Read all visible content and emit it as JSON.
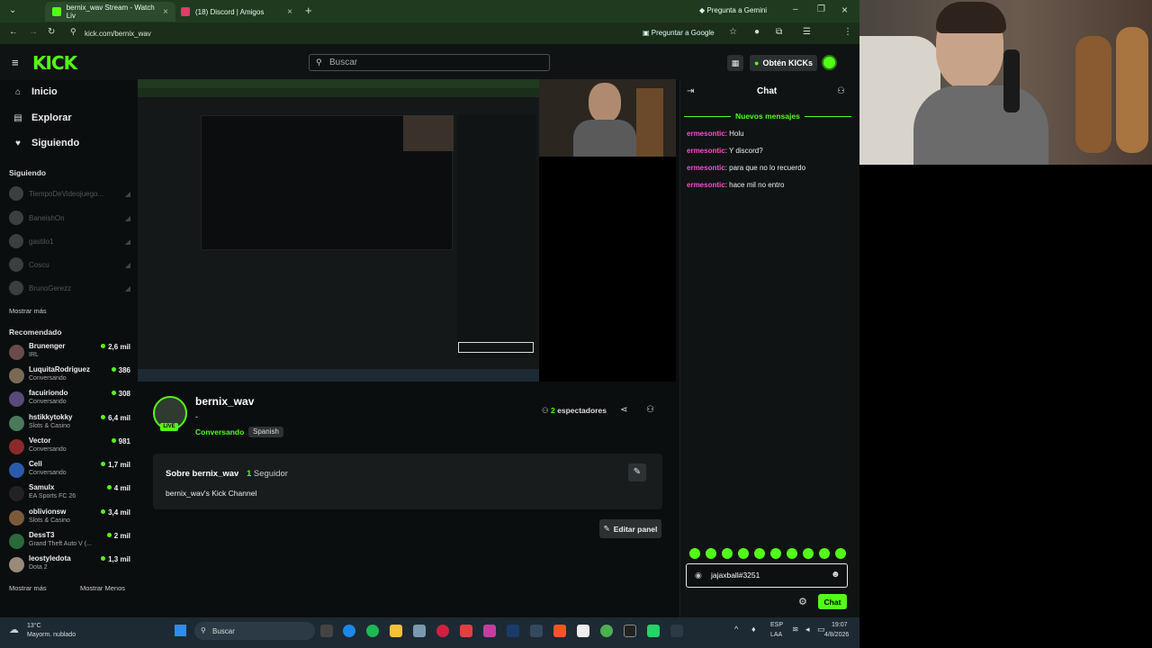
{
  "browser": {
    "tabs": [
      {
        "label": "bernix_wav Stream - Watch Liv",
        "favicon_color": "#53fc18"
      },
      {
        "label": "(18) Discord | Amigos",
        "favicon_color": "#5865f2"
      }
    ],
    "gemini_label": "Pregunta a Gemini",
    "url": "kick.com/bernix_wav",
    "ask_google_label": "Preguntar a Google"
  },
  "header": {
    "logo": "KICK",
    "search_placeholder": "Buscar",
    "get_kicks_label": "Obtén KICKs"
  },
  "sidebar": {
    "nav": [
      {
        "label": "Inicio",
        "icon": "home-icon"
      },
      {
        "label": "Explorar",
        "icon": "explore-icon"
      },
      {
        "label": "Siguiendo",
        "icon": "heart-icon"
      }
    ],
    "following_title": "Siguiendo",
    "following": [
      {
        "name": "TiempoDeVideojuego..."
      },
      {
        "name": "BaneishOn"
      },
      {
        "name": "gastilo1"
      },
      {
        "name": "Coscu"
      },
      {
        "name": "BrunoGerezz"
      }
    ],
    "show_more_1": "Mostrar más",
    "recommended_title": "Recomendado",
    "recommended": [
      {
        "name": "Brunenger",
        "category": "IRL",
        "viewers": "2,6 mil"
      },
      {
        "name": "LuquitaRodriguez",
        "category": "Conversando",
        "viewers": "386"
      },
      {
        "name": "facuiriondo",
        "category": "Conversando",
        "viewers": "308"
      },
      {
        "name": "hstikkytokky",
        "category": "Slots & Casino",
        "viewers": "6,4 mil"
      },
      {
        "name": "Vector",
        "category": "Conversando",
        "viewers": "981"
      },
      {
        "name": "Cell",
        "category": "Conversando",
        "viewers": "1,7 mil"
      },
      {
        "name": "Samulx",
        "category": "EA Sports FC 26",
        "viewers": "4 mil"
      },
      {
        "name": "oblivionsw",
        "category": "Slots & Casino",
        "viewers": "3,4 mil"
      },
      {
        "name": "DessT3",
        "category": "Grand Theft Auto V (...",
        "viewers": "2 mil"
      },
      {
        "name": "leostyledota",
        "category": "Dota 2",
        "viewers": "1,3 mil"
      }
    ],
    "show_more_2": "Mostrar más",
    "show_less": "Mostrar Menos"
  },
  "stream": {
    "streamer": "bernix_wav",
    "live_badge": "LIVE",
    "title_line": "-",
    "category": "Conversando",
    "language_tag": "Spanish",
    "viewers_count": "2",
    "viewers_label": "espectadores",
    "about_title": "Sobre bernix_wav",
    "followers_count": "1",
    "followers_label": "Seguidor",
    "about_text": "bernix_wav's Kick Channel",
    "edit_panel_label": "Editar panel"
  },
  "chat": {
    "title": "Chat",
    "new_messages": "Nuevos mensajes",
    "messages": [
      {
        "user": "ermesontic",
        "text": ": Holu"
      },
      {
        "user": "ermesontic",
        "text": ": Y discord?"
      },
      {
        "user": "ermesontic",
        "text": ": para que no lo recuerdo"
      },
      {
        "user": "ermesontic",
        "text": ": hace mil no entro"
      }
    ],
    "input_value": "jajaxball#3251",
    "send_label": "Chat"
  },
  "taskbar": {
    "weather_temp": "13°C",
    "weather_desc": "Mayorm. nublado",
    "search_label": "Buscar",
    "lang_1": "ESP",
    "lang_2": "LAA",
    "time": "19:07",
    "date": "4/8/2026"
  }
}
